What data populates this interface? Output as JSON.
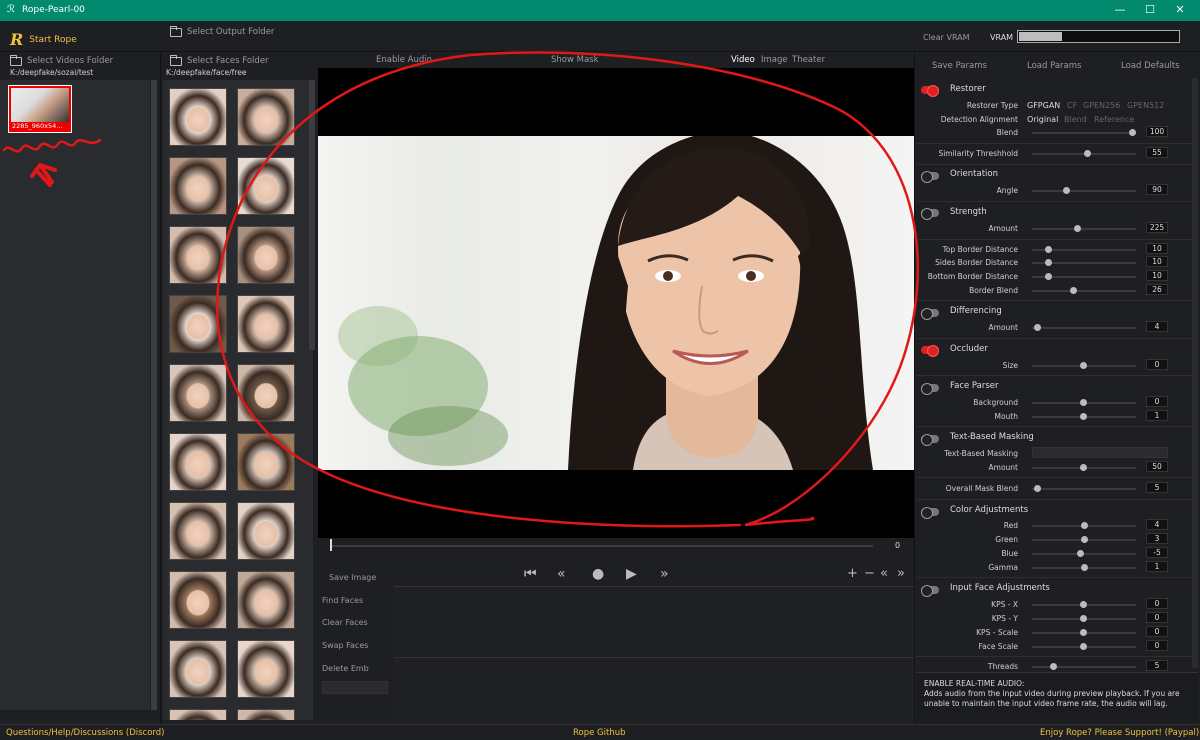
{
  "window": {
    "title": "Rope-Pearl-00",
    "minimize": "—",
    "maximize": "☐",
    "close": "✕"
  },
  "topbar": {
    "start_label": "Start Rope",
    "output_folder": "Select Output Folder",
    "clear_vram": "Clear VRAM",
    "vram_label": "VRAM",
    "vram_used": 0.27
  },
  "videos": {
    "select_label": "Select Videos Folder",
    "path": "K:/deepfake/sozai/test",
    "items": [
      {
        "label": "2285_960x54..."
      }
    ]
  },
  "faces": {
    "select_label": "Select Faces Folder",
    "path": "K:/deepfake/face/free"
  },
  "center": {
    "tabs": {
      "audio": "Enable Audio",
      "mask": "Show Mask",
      "video": "Video",
      "image": "Image",
      "theater": "Theater"
    },
    "frame": "0",
    "save_image": "Save Image",
    "find_faces": "Find Faces",
    "clear_faces": "Clear Faces",
    "swap_faces": "Swap Faces",
    "delete_emb": "Delete Emb"
  },
  "params": {
    "save": "Save Params",
    "load": "Load Params",
    "defaults": "Load Defaults",
    "restorer": {
      "title": "Restorer",
      "type_label": "Restorer Type",
      "types": [
        "GFPGAN",
        "CF",
        "GPEN256",
        "GPEN512"
      ],
      "align_label": "Detection Alignment",
      "aligns": [
        "Original",
        "Blend",
        "Reference"
      ],
      "blend_label": "Blend",
      "blend": "100"
    },
    "similarity": {
      "label": "Similarity Threshhold",
      "value": "55"
    },
    "orientation": {
      "title": "Orientation",
      "angle_label": "Angle",
      "angle": "90"
    },
    "strength": {
      "title": "Strength",
      "amount_label": "Amount",
      "amount": "225"
    },
    "border": {
      "top_label": "Top Border Distance",
      "top": "10",
      "sides_label": "Sides Border Distance",
      "sides": "10",
      "bottom_label": "Bottom Border Distance",
      "bottom": "10",
      "blend_label": "Border Blend",
      "blend": "26"
    },
    "differencing": {
      "title": "Differencing",
      "amount_label": "Amount",
      "amount": "4"
    },
    "occluder": {
      "title": "Occluder",
      "size_label": "Size",
      "size": "0"
    },
    "face_parser": {
      "title": "Face Parser",
      "bg_label": "Background",
      "bg": "0",
      "mouth_label": "Mouth",
      "mouth": "1"
    },
    "text_mask": {
      "title": "Text-Based Masking",
      "field_label": "Text-Based Masking",
      "amount_label": "Amount",
      "amount": "50"
    },
    "overall_blend": {
      "label": "Overall Mask Blend",
      "value": "5"
    },
    "color": {
      "title": "Color Adjustments",
      "red_label": "Red",
      "red": "4",
      "green_label": "Green",
      "green": "3",
      "blue_label": "Blue",
      "blue": "-5",
      "gamma_label": "Gamma",
      "gamma": "1"
    },
    "input_face": {
      "title": "Input Face Adjustments",
      "kpsx_label": "KPS - X",
      "kpsx": "0",
      "kpsy_label": "KPS - Y",
      "kpsy": "0",
      "kpss_label": "KPS - Scale",
      "kpss": "0",
      "fs_label": "Face Scale",
      "fs": "0"
    },
    "threads": {
      "label": "Threads",
      "value": "5"
    }
  },
  "info": {
    "title": "ENABLE REAL-TIME AUDIO:",
    "body": "Adds audio from the input video during preview playback. If you are unable to maintain the input video frame rate, the audio will lag."
  },
  "footer": {
    "discord": "Questions/Help/Discussions (Discord)",
    "github": "Rope Github",
    "support": "Enjoy Rope? Please Support! (Paypal)"
  },
  "colors": {
    "accent": "#f0c040",
    "titlebar": "#028a6f",
    "toggle_on": "#dd2222",
    "annotation": "#e01818"
  }
}
